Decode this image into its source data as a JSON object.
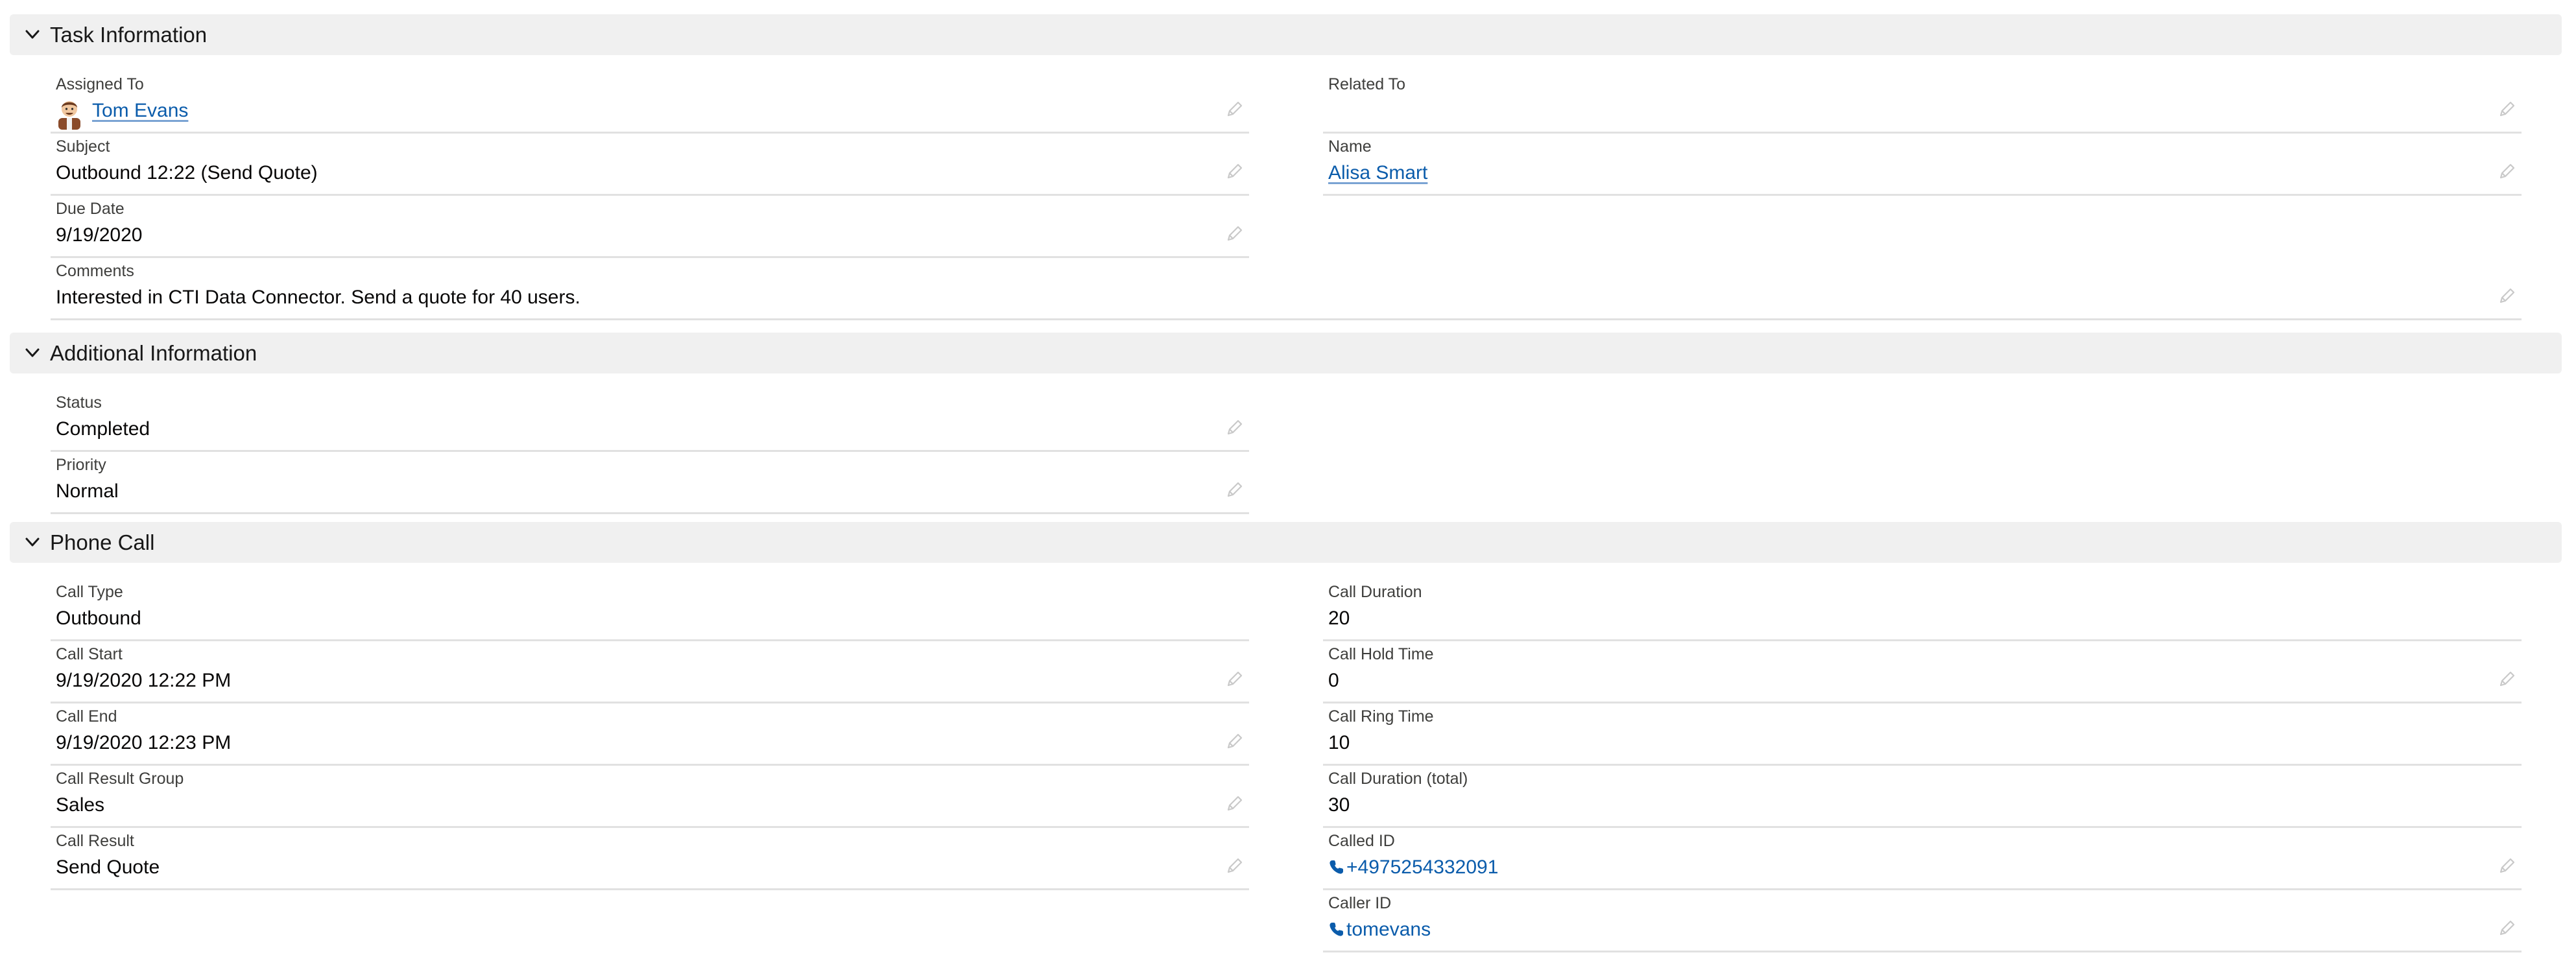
{
  "sections": {
    "task": {
      "title": "Task Information",
      "assigned_to": {
        "label": "Assigned To",
        "value": "Tom Evans"
      },
      "related_to": {
        "label": "Related To",
        "value": ""
      },
      "subject": {
        "label": "Subject",
        "value": "Outbound 12:22 (Send Quote)"
      },
      "name": {
        "label": "Name",
        "value": "Alisa Smart"
      },
      "due_date": {
        "label": "Due Date",
        "value": "9/19/2020"
      },
      "comments": {
        "label": "Comments",
        "value": "Interested in CTI Data Connector. Send a quote for 40 users."
      }
    },
    "additional": {
      "title": "Additional Information",
      "status": {
        "label": "Status",
        "value": "Completed"
      },
      "priority": {
        "label": "Priority",
        "value": "Normal"
      }
    },
    "phone": {
      "title": "Phone Call",
      "call_type": {
        "label": "Call Type",
        "value": "Outbound"
      },
      "call_duration": {
        "label": "Call Duration",
        "value": "20"
      },
      "call_start": {
        "label": "Call Start",
        "value": "9/19/2020 12:22 PM"
      },
      "call_hold_time": {
        "label": "Call Hold Time",
        "value": "0"
      },
      "call_end": {
        "label": "Call End",
        "value": "9/19/2020 12:23 PM"
      },
      "call_ring_time": {
        "label": "Call Ring Time",
        "value": "10"
      },
      "call_result_group": {
        "label": "Call Result Group",
        "value": "Sales"
      },
      "call_duration_total": {
        "label": "Call Duration (total)",
        "value": "30"
      },
      "call_result": {
        "label": "Call Result",
        "value": "Send Quote"
      },
      "called_id": {
        "label": "Called ID",
        "value": "+4975254332091"
      },
      "caller_id": {
        "label": "Caller ID",
        "value": "tomevans"
      }
    }
  },
  "icons": {
    "chevron": "chevron-down-icon",
    "edit": "pencil-icon",
    "phone": "phone-icon",
    "avatar": "user-avatar"
  },
  "colors": {
    "link": "#0b5cab",
    "header_bg": "#f0f0f0",
    "divider": "#e1e1e1",
    "label": "#3e3e3c"
  }
}
